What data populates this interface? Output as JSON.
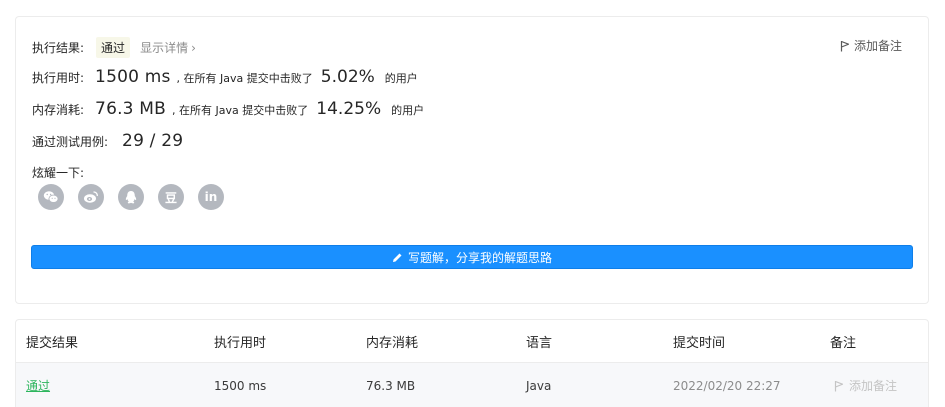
{
  "result": {
    "label": "执行结果:",
    "status": "通过",
    "details_link": "显示详情",
    "details_chevron": "›",
    "add_note": "添加备注"
  },
  "runtime": {
    "label": "执行用时:",
    "value": "1500 ms",
    "middle": ", 在所有 Java 提交中击败了",
    "percent": "5.02%",
    "suffix": "的用户"
  },
  "memory": {
    "label": "内存消耗:",
    "value": "76.3 MB",
    "middle": ", 在所有 Java 提交中击败了",
    "percent": "14.25%",
    "suffix": "的用户"
  },
  "tests": {
    "label": "通过测试用例:",
    "value": "29 / 29"
  },
  "share": {
    "label": "炫耀一下:",
    "icons": [
      "wechat-icon",
      "weibo-icon",
      "qq-icon",
      "douban-icon",
      "linkedin-icon"
    ],
    "douban_glyph": "豆",
    "linkedin_glyph": "in"
  },
  "write_button": "写题解，分享我的解题思路",
  "table": {
    "headers": [
      "提交结果",
      "执行用时",
      "内存消耗",
      "语言",
      "提交时间",
      "备注"
    ],
    "rows": [
      {
        "result": "通过",
        "runtime": "1500 ms",
        "memory": "76.3 MB",
        "language": "Java",
        "time": "2022/02/20 22:27",
        "note": "添加备注"
      }
    ]
  },
  "colors": {
    "accent": "#1a90ff",
    "pass_green": "#2db55d",
    "icon_gray": "#b4b8bf"
  }
}
